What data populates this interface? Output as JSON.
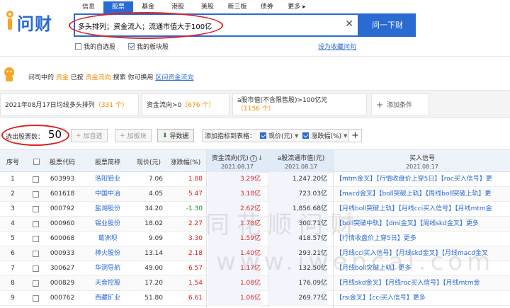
{
  "brand": "问财",
  "nav_tabs": [
    {
      "label": "信息",
      "active": false
    },
    {
      "label": "股票",
      "active": true
    },
    {
      "label": "基金",
      "active": false
    },
    {
      "label": "港股",
      "active": false
    },
    {
      "label": "美股",
      "active": false
    },
    {
      "label": "新三板",
      "active": false
    },
    {
      "label": "债券",
      "active": false
    },
    {
      "label": "更多 ▸",
      "active": false
    }
  ],
  "search": {
    "query": "多头排列；资金流入；流通市值大于100亿",
    "button": "问一下财",
    "clear_icon": "close-icon"
  },
  "options": {
    "my_watchlist": "我的自选股",
    "my_sector": "我的板块股",
    "set_favorite": "设为收藏问句"
  },
  "info": {
    "p1": "问司中的",
    "w1": "资金",
    "p2": "已按",
    "w2": "资金流向",
    "p3": "搜索 你可换用",
    "link": "区间资金流向"
  },
  "conditions": [
    {
      "label": "2021年08月17日均线多头排列",
      "count": "（331 个）"
    },
    {
      "label": "资金流向>0",
      "count": "（676 个）"
    },
    {
      "label": "a股市值(不含限售股)>100亿元",
      "count": "（1156 个）"
    },
    {
      "label": "添加条件",
      "count": ""
    }
  ],
  "toolbar": {
    "count_label": "选出股票数：",
    "count": "50",
    "add_watch": "加自选",
    "add_sector": "加板块",
    "export": "导数据",
    "add_indicator": "添加指标到表格：",
    "chip1": "现价(元)",
    "chip2": "涨跌幅(%)"
  },
  "table": {
    "headers": {
      "no": "序号",
      "code": "股票代码",
      "name": "股票简称",
      "price": "现价(元)",
      "change": "涨跌幅(%)",
      "flow": "资金流向(元)",
      "flow_date": "2021.08.17",
      "cap": "a股流通市值(元)",
      "cap_date": "2021.08.17",
      "signal": "买入信号",
      "signal_date": "2021.08.17"
    },
    "rows": [
      {
        "no": "1",
        "code": "603993",
        "name": "洛阳钼业",
        "price": "7.06",
        "change": "1.88",
        "dir": "up",
        "flow": "3.29亿",
        "cap": "1,247.20亿",
        "signal": "【mtm金叉】【行情收盘价上穿5日】【roc买入信号】更"
      },
      {
        "no": "2",
        "code": "601618",
        "name": "中国中冶",
        "price": "4.05",
        "change": "5.47",
        "dir": "up",
        "flow": "3.18亿",
        "cap": "723.03亿",
        "signal": "【macd金叉】【boll突破上轨】【周线boll突破上轨】更"
      },
      {
        "no": "3",
        "code": "000792",
        "name": "盐湖股份",
        "price": "34.20",
        "change": "-1.30",
        "dir": "down",
        "flow": "2.62亿",
        "cap": "1,856.68亿",
        "signal": "【月线boll突破上轨】【月线cci买入信号】【月线mtm金"
      },
      {
        "no": "4",
        "code": "000960",
        "name": "锡业股份",
        "price": "18.02",
        "change": "2.27",
        "dir": "up",
        "flow": "1.78亿",
        "cap": "300.71亿",
        "signal": "【boll突破中轨】【dmi金叉】【周线skd金叉】更多"
      },
      {
        "no": "5",
        "code": "600068",
        "name": "葛洲坝",
        "price": "9.09",
        "change": "3.30",
        "dir": "up",
        "flow": "1.59亿",
        "cap": "418.57亿",
        "signal": "【行情收盘价上穿5日】更多"
      },
      {
        "no": "6",
        "code": "000933",
        "name": "神火股份",
        "price": "13.14",
        "change": "2.18",
        "dir": "up",
        "flow": "1.40亿",
        "cap": "293.21亿",
        "signal": "【月线cci买入信号】【月线skd金叉】【月线macd金叉"
      },
      {
        "no": "7",
        "code": "300627",
        "name": "华测导航",
        "price": "49.00",
        "change": "6.57",
        "dir": "up",
        "flow": "1.17亿",
        "cap": "132.50亿",
        "signal": "【月线boll突破上轨】更多"
      },
      {
        "no": "8",
        "code": "000829",
        "name": "天音控股",
        "price": "17.20",
        "change": "1.54",
        "dir": "up",
        "flow": "1.08亿",
        "cap": "176.09亿",
        "signal": "【月线skd金叉】【月线roc买入信号】【月线mtm金"
      },
      {
        "no": "9",
        "code": "000762",
        "name": "西藏矿业",
        "price": "51.80",
        "change": "6.61",
        "dir": "up",
        "flow": "1.06亿",
        "cap": "269.77亿",
        "signal": "【rsi金叉】【cci买入信号】更多"
      }
    ]
  },
  "watermark_line1": "同花顺问财",
  "watermark_line2": "www.iwencai.com",
  "colors": {
    "primary": "#2a6ad3",
    "up": "#e02020",
    "down": "#1a8f1a",
    "accent": "#f08a00",
    "annotation": "#e02020"
  }
}
